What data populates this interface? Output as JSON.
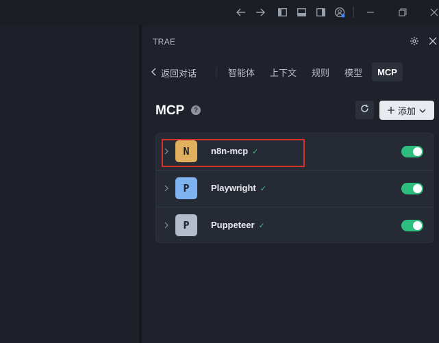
{
  "titlebar": {
    "icons": [
      "arrow-left-icon",
      "arrow-right-icon",
      "toggle-left-panel-icon",
      "toggle-bottom-panel-icon",
      "toggle-right-panel-icon",
      "account-icon",
      "minimize-icon",
      "restore-icon",
      "close-icon"
    ]
  },
  "panel": {
    "title": "TRAE",
    "back_label": "返回对话",
    "tabs": [
      {
        "label": "智能体",
        "active": false
      },
      {
        "label": "上下文",
        "active": false
      },
      {
        "label": "规则",
        "active": false
      },
      {
        "label": "模型",
        "active": false
      },
      {
        "label": "MCP",
        "active": true
      }
    ]
  },
  "mcp": {
    "heading": "MCP",
    "help_glyph": "?",
    "add_label": "添加",
    "servers": [
      {
        "initial": "N",
        "name": "n8n-mcp",
        "avatar_color": "#e0b05e",
        "status": "✓",
        "enabled": true,
        "highlighted": true
      },
      {
        "initial": "P",
        "name": "Playwright",
        "avatar_color": "#7fb2f0",
        "status": "✓",
        "enabled": true,
        "highlighted": false
      },
      {
        "initial": "P",
        "name": "Puppeteer",
        "avatar_color": "#b2bccd",
        "status": "✓",
        "enabled": true,
        "highlighted": false
      }
    ]
  },
  "colors": {
    "accent_toggle": "#2dbd7e",
    "highlight_border": "#d9302a",
    "account_badge": "#3b82f6"
  }
}
